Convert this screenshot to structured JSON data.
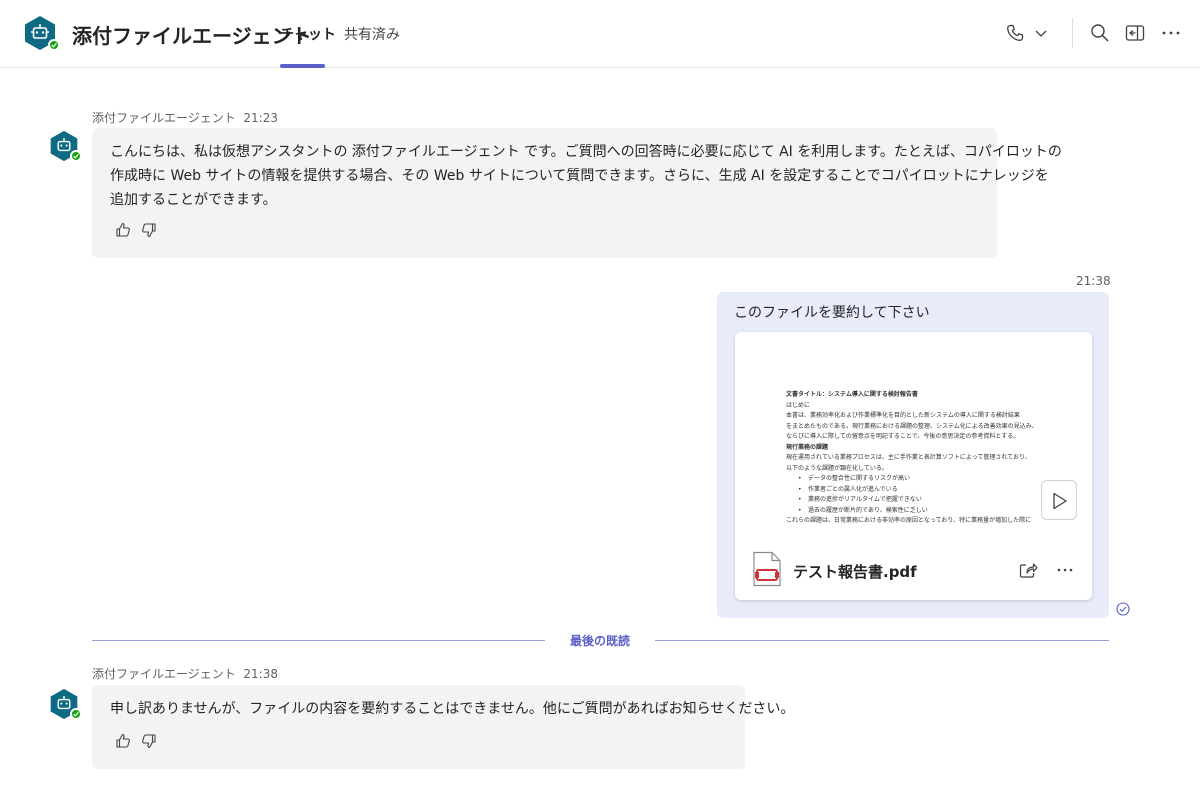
{
  "header": {
    "title": "添付ファイルエージェント",
    "tabs": [
      {
        "label": "チャット",
        "active": true
      },
      {
        "label": "共有済み",
        "active": false
      }
    ],
    "icons": [
      "phone-icon",
      "chevron-down-icon",
      "search-icon",
      "pop-out-icon",
      "more-icon"
    ]
  },
  "colors": {
    "accent": "#5b5fc7",
    "bot_avatar": "#0f6b83",
    "presence": "#13a10e",
    "my_bubble": "#e8ebfa",
    "bot_bubble": "#f3f3f3"
  },
  "messages": {
    "m1": {
      "sender": "添付ファイルエージェント",
      "time": "21:23",
      "lines": [
        "こんにちは、私は仮想アシスタントの 添付ファイルエージェント です。ご質問への回答時に必要に応じて AI を利用します。たとえば、コパイロットの",
        "作成時に Web サイトの情報を提供する場合、その Web サイトについて質問できます。さらに、生成 AI を設定することでコパイロットにナレッジを",
        "追加することができます。"
      ]
    },
    "m2": {
      "time": "21:38",
      "text": "このファイルを要約して下さい",
      "attachment": {
        "file_name": "テスト報告書.pdf",
        "preview": {
          "title": "文書タイトル：システム導入に関する検討報告書",
          "lines": [
            "はじめに",
            "本書は、業務効率化および作業標準化を目的とした新システムの導入に関する検討結果",
            "をまとめたものである。現行業務における課題の整理、システム化による改善効果の見込み、",
            "ならびに導入に際しての留意点を明記することで、今後の意思決定の参考資料とする。",
            "現行業務の課題",
            "現在運用されている業務プロセスは、主に手作業と表計算ソフトによって管理されており、",
            "以下のような課題が顕在化している。"
          ],
          "bullets": [
            "データの整合性に関するリスクが高い",
            "作業者ごとの属人化が進んでいる",
            "業務の進捗がリアルタイムで把握できない",
            "過去の履歴が断片的であり、検索性に乏しい"
          ],
          "last_line": "これらの課題は、日常業務における非効率の原因となっており、特に業務量が増加した際に"
        }
      }
    },
    "divider_label": "最後の既読",
    "m3": {
      "sender": "添付ファイルエージェント",
      "time": "21:38",
      "text": "申し訳ありませんが、ファイルの内容を要約することはできません。他にご質問があればお知らせください。"
    }
  }
}
